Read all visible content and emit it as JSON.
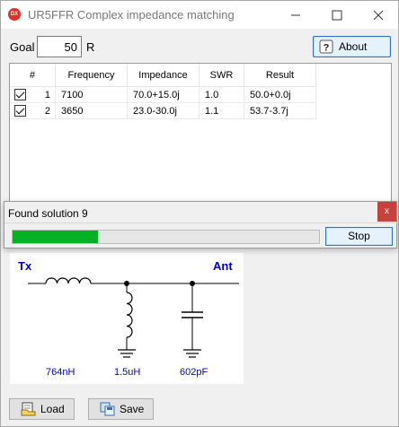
{
  "window": {
    "title": "UR5FFR Complex impedance matching",
    "app_icon_text": "DX"
  },
  "goal": {
    "label": "Goal",
    "value": "50",
    "unit": "R"
  },
  "about_button": {
    "label": "About"
  },
  "table": {
    "columns": [
      "#",
      "Frequency",
      "Impedance",
      "SWR",
      "Result"
    ],
    "rows": [
      {
        "checked": true,
        "num": "1",
        "frequency": "7100",
        "impedance": "70.0+15.0j",
        "swr": "1.0",
        "result": "50.0+0.0j"
      },
      {
        "checked": true,
        "num": "2",
        "frequency": "3650",
        "impedance": "23.0-30.0j",
        "swr": "1.1",
        "result": "53.7-3.7j"
      }
    ]
  },
  "progress_popup": {
    "title": "Found solution 9",
    "close_symbol": "x",
    "progress_fraction": 0.28,
    "progress_color": "#06b025",
    "stop_label": "Stop"
  },
  "schematic": {
    "input_label": "Tx",
    "output_label": "Ant",
    "components": [
      {
        "name": "series-inductor",
        "value": "764nH"
      },
      {
        "name": "shunt-inductor",
        "value": "1.5uH"
      },
      {
        "name": "shunt-capacitor",
        "value": "602pF"
      }
    ],
    "label_color": "#0000c0"
  },
  "footer": {
    "load_label": "Load",
    "save_label": "Save"
  }
}
